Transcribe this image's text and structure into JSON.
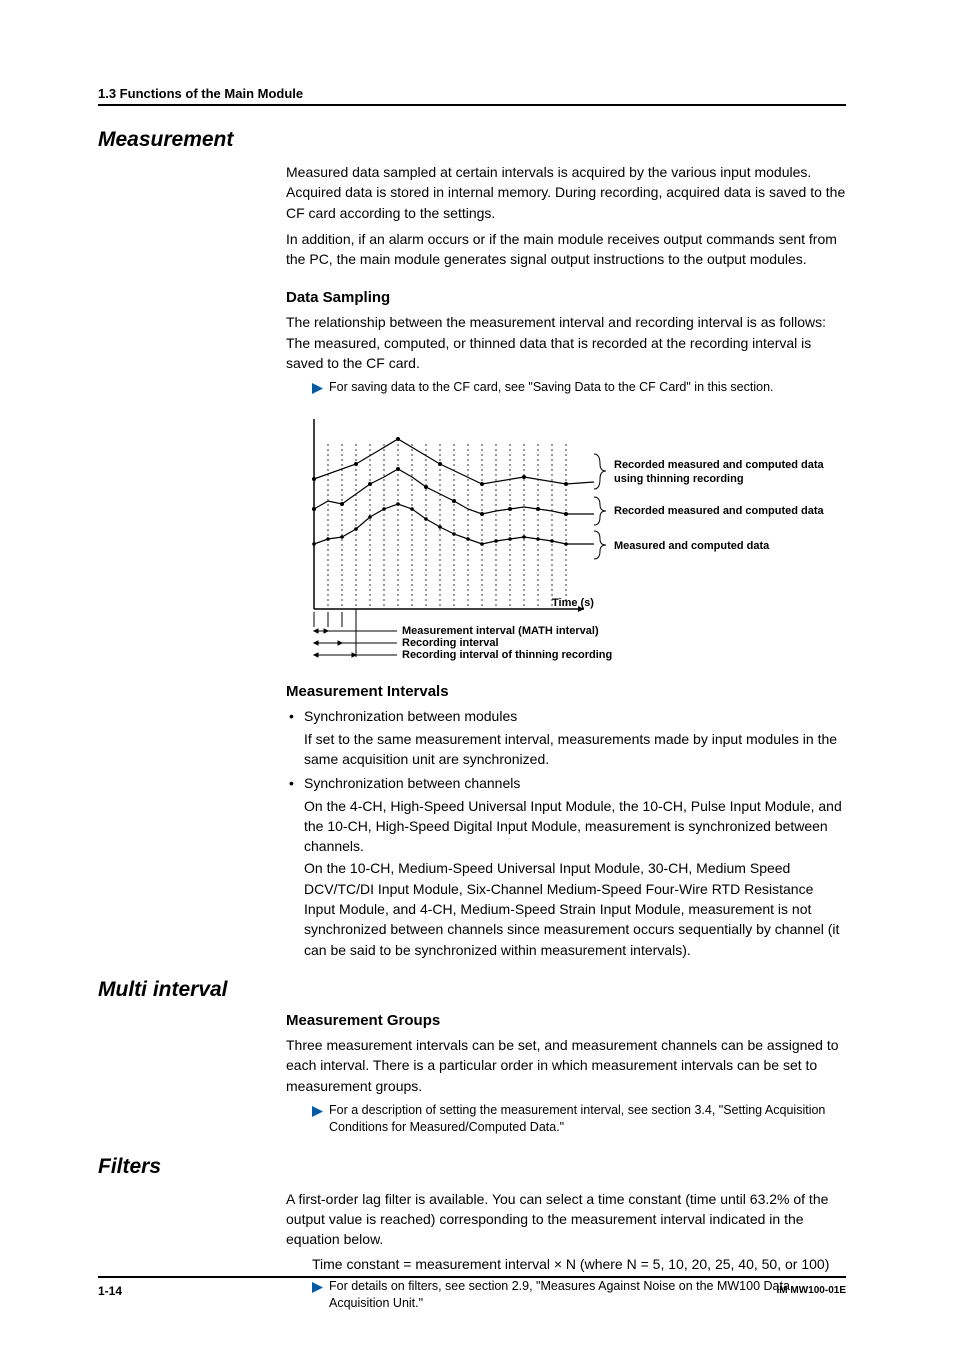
{
  "running_head": "1.3  Functions of the Main Module",
  "section_measurement": {
    "title": "Measurement",
    "intro_p1": "Measured data sampled at certain intervals is acquired by the various input modules. Acquired data is stored in internal memory. During recording, acquired data is saved to the CF card according to the settings.",
    "intro_p2": "In addition, if an alarm occurs or if the main module receives output commands sent from the PC, the main module generates signal output instructions to the output modules.",
    "data_sampling": {
      "heading": "Data Sampling",
      "p": "The relationship between the measurement interval and recording interval is as follows: The measured, computed, or thinned data that is recorded at the recording interval is saved to the CF card.",
      "note": "For saving data to the CF card, see \"Saving Data to the CF Card\" in this section."
    },
    "diagram": {
      "time_axis": "Time (s)",
      "label_thinning": "Recorded measured and computed data using thinning recording",
      "label_recorded": "Recorded measured and computed data",
      "label_measured": "Measured and computed data",
      "interval_meas": "Measurement interval (MATH interval)",
      "interval_rec": "Recording interval",
      "interval_thin": "Recording interval of thinning recording"
    },
    "measurement_intervals": {
      "heading": "Measurement Intervals",
      "bullet1_title": "Synchronization between modules",
      "bullet1_body": "If set to the same measurement interval, measurements made by input modules in the same acquisition unit are synchronized.",
      "bullet2_title": "Synchronization between channels",
      "bullet2_body1": "On the 4-CH, High-Speed Universal Input Module, the 10-CH, Pulse Input Module, and the 10-CH, High-Speed Digital Input Module, measurement is synchronized between channels.",
      "bullet2_body2": "On the 10-CH, Medium-Speed Universal Input Module, 30-CH, Medium Speed DCV/TC/DI Input Module, Six-Channel Medium-Speed Four-Wire RTD Resistance Input Module, and 4-CH, Medium-Speed Strain Input Module, measurement is not synchronized between channels since measurement occurs sequentially by channel (it can be said to be synchronized within measurement intervals)."
    }
  },
  "section_multi": {
    "title": "Multi interval",
    "heading": "Measurement Groups",
    "p": "Three measurement intervals can be set, and measurement channels can be assigned to each interval. There is a particular order in which measurement intervals can be set to measurement groups.",
    "note": "For a description of setting the measurement interval, see section 3.4, \"Setting Acquisition Conditions for Measured/Computed Data.\""
  },
  "section_filters": {
    "title": "Filters",
    "p": "A first-order lag filter is available. You can select a time constant (time until 63.2% of the output value is reached) corresponding to the measurement interval indicated in the equation below.",
    "equation": "Time constant = measurement interval × N (where N = 5, 10, 20, 25, 40, 50, or 100)",
    "note": "For details on filters, see section 2.9, \"Measures Against Noise on the MW100 Data Acquisition Unit.\""
  },
  "footer": {
    "page_number": "1-14",
    "doc_id": "IM MW100-01E"
  }
}
